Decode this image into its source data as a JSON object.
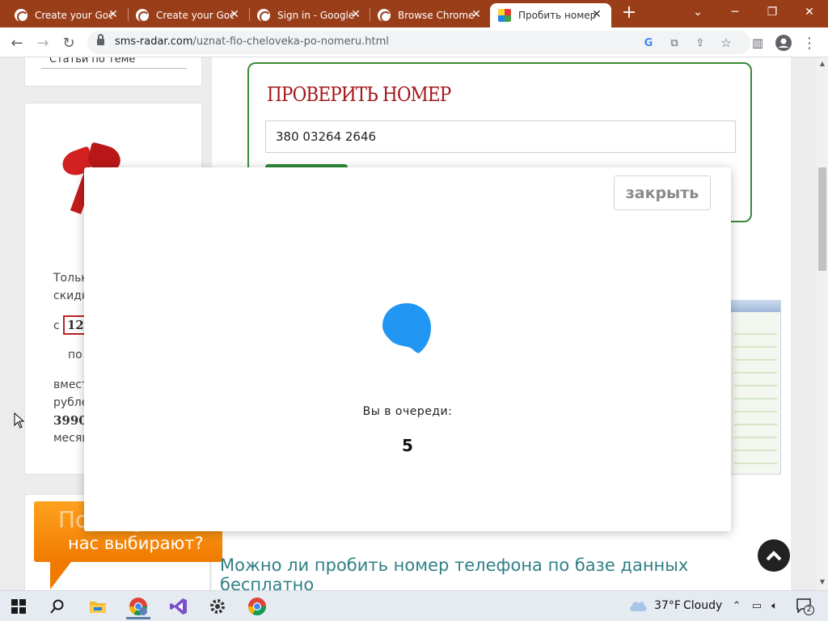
{
  "browser": {
    "tabs": [
      {
        "title": "Create your Goo",
        "active": false
      },
      {
        "title": "Create your Goo",
        "active": false
      },
      {
        "title": "Sign in - Google",
        "active": false
      },
      {
        "title": "Browse Chrome",
        "active": false
      },
      {
        "title": "Пробить номер",
        "active": true
      }
    ],
    "tab_close_glyph": "✕",
    "new_tab_glyph": "+",
    "url_host": "sms-radar.com",
    "url_path": "/uznat-fio-cheloveka-po-nomeru.html",
    "theme_color": "#9a3e19"
  },
  "sidebar": {
    "related_label": "Статьи по теме",
    "promo": {
      "line1": "Тольк",
      "line2": "скидк",
      "from_prefix": "с",
      "price_from": "12",
      "to_prefix": "по",
      "instead": "вмест",
      "rubles": "рубле",
      "old_price": "3990",
      "month": "месяц"
    }
  },
  "check_form": {
    "title": "ПРОВЕРИТЬ НОМЕР",
    "phone_value": "380 03264 2646",
    "border_color": "#3a8a3a"
  },
  "why_banner": {
    "line1": "Почему",
    "line2": "нас выбирают?"
  },
  "article": {
    "title": "Можно ли пробить номер телефона по базе данных бесплатно"
  },
  "modal": {
    "close_label": "закрыть",
    "queue_label": "Вы в очереди:",
    "queue_position": "5",
    "loader_color": "#2196f3"
  },
  "taskbar": {
    "weather_temp": "37°F",
    "weather_text": "Cloudy",
    "notification_count": "2"
  }
}
